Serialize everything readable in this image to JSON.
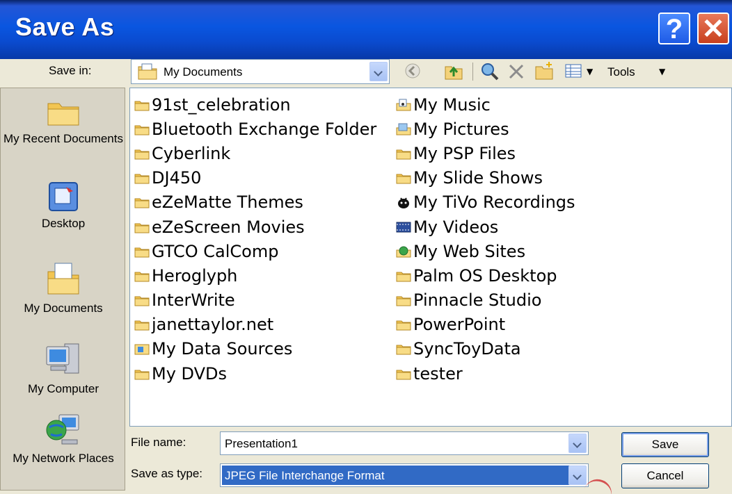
{
  "window": {
    "title": "Save As",
    "help_label": "?",
    "close_label": "✕"
  },
  "save_in": {
    "label": "Save in:",
    "value": "My Documents"
  },
  "toolbar": {
    "tools_label": "Tools"
  },
  "places": [
    {
      "label": "My Recent Documents",
      "icon": "folder-icon"
    },
    {
      "label": "Desktop",
      "icon": "desktop-icon"
    },
    {
      "label": "My Documents",
      "icon": "my-documents-icon"
    },
    {
      "label": "My Computer",
      "icon": "computer-icon"
    },
    {
      "label": "My Network Places",
      "icon": "network-icon"
    }
  ],
  "files": {
    "col1": [
      {
        "name": "91st_celebration",
        "icon": "folder-icon"
      },
      {
        "name": "Bluetooth Exchange Folder",
        "icon": "folder-icon"
      },
      {
        "name": "Cyberlink",
        "icon": "folder-icon"
      },
      {
        "name": "DJ450",
        "icon": "folder-icon"
      },
      {
        "name": "eZeMatte Themes",
        "icon": "folder-icon"
      },
      {
        "name": "eZeScreen Movies",
        "icon": "folder-icon"
      },
      {
        "name": "GTCO CalComp",
        "icon": "folder-icon"
      },
      {
        "name": "Heroglyph",
        "icon": "folder-icon"
      },
      {
        "name": "InterWrite",
        "icon": "folder-icon"
      },
      {
        "name": "janettaylor.net",
        "icon": "folder-icon"
      },
      {
        "name": "My Data Sources",
        "icon": "data-sources-icon"
      },
      {
        "name": "My DVDs",
        "icon": "folder-icon"
      }
    ],
    "col2": [
      {
        "name": "My Music",
        "icon": "music-folder-icon"
      },
      {
        "name": "My Pictures",
        "icon": "pictures-folder-icon"
      },
      {
        "name": "My PSP Files",
        "icon": "folder-icon"
      },
      {
        "name": "My Slide Shows",
        "icon": "folder-icon"
      },
      {
        "name": "My TiVo Recordings",
        "icon": "tivo-icon"
      },
      {
        "name": "My Videos",
        "icon": "video-folder-icon"
      },
      {
        "name": "My Web Sites",
        "icon": "web-folder-icon"
      },
      {
        "name": "Palm OS Desktop",
        "icon": "folder-icon"
      },
      {
        "name": "Pinnacle Studio",
        "icon": "folder-icon"
      },
      {
        "name": "PowerPoint",
        "icon": "folder-icon"
      },
      {
        "name": "SyncToyData",
        "icon": "folder-icon"
      },
      {
        "name": "tester",
        "icon": "folder-icon"
      }
    ]
  },
  "file_name": {
    "label": "File name:",
    "value": "Presentation1"
  },
  "save_as_type": {
    "label": "Save as type:",
    "value": "JPEG File Interchange Format"
  },
  "buttons": {
    "save": "Save",
    "cancel": "Cancel"
  },
  "colors": {
    "titlebar": "#0A56E0",
    "dialog_bg": "#ECE9D8",
    "selection": "#316AC5"
  }
}
